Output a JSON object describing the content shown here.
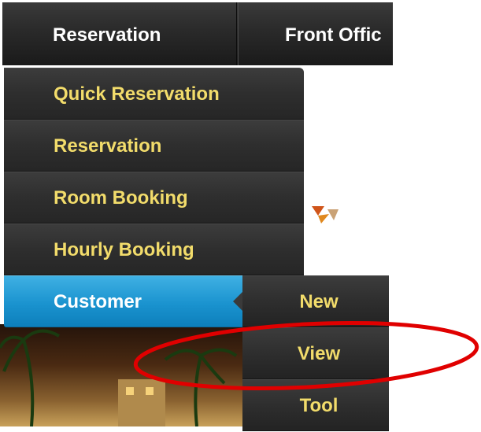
{
  "topbar": {
    "items": [
      {
        "label": "Reservation"
      },
      {
        "label": "Front Offic"
      }
    ]
  },
  "dropdown": {
    "items": [
      {
        "label": "Quick Reservation"
      },
      {
        "label": "Reservation"
      },
      {
        "label": "Room Booking"
      },
      {
        "label": "Hourly Booking"
      },
      {
        "label": "Customer",
        "active": true
      }
    ]
  },
  "submenu": {
    "items": [
      {
        "label": "New"
      },
      {
        "label": "View"
      },
      {
        "label": "Tool"
      }
    ]
  },
  "colors": {
    "menu_bg": "#2e2e2e",
    "menu_text": "#f2dc6b",
    "active_bg": "#1a93cf",
    "active_text": "#ffffff",
    "annotation": "#e00000"
  }
}
